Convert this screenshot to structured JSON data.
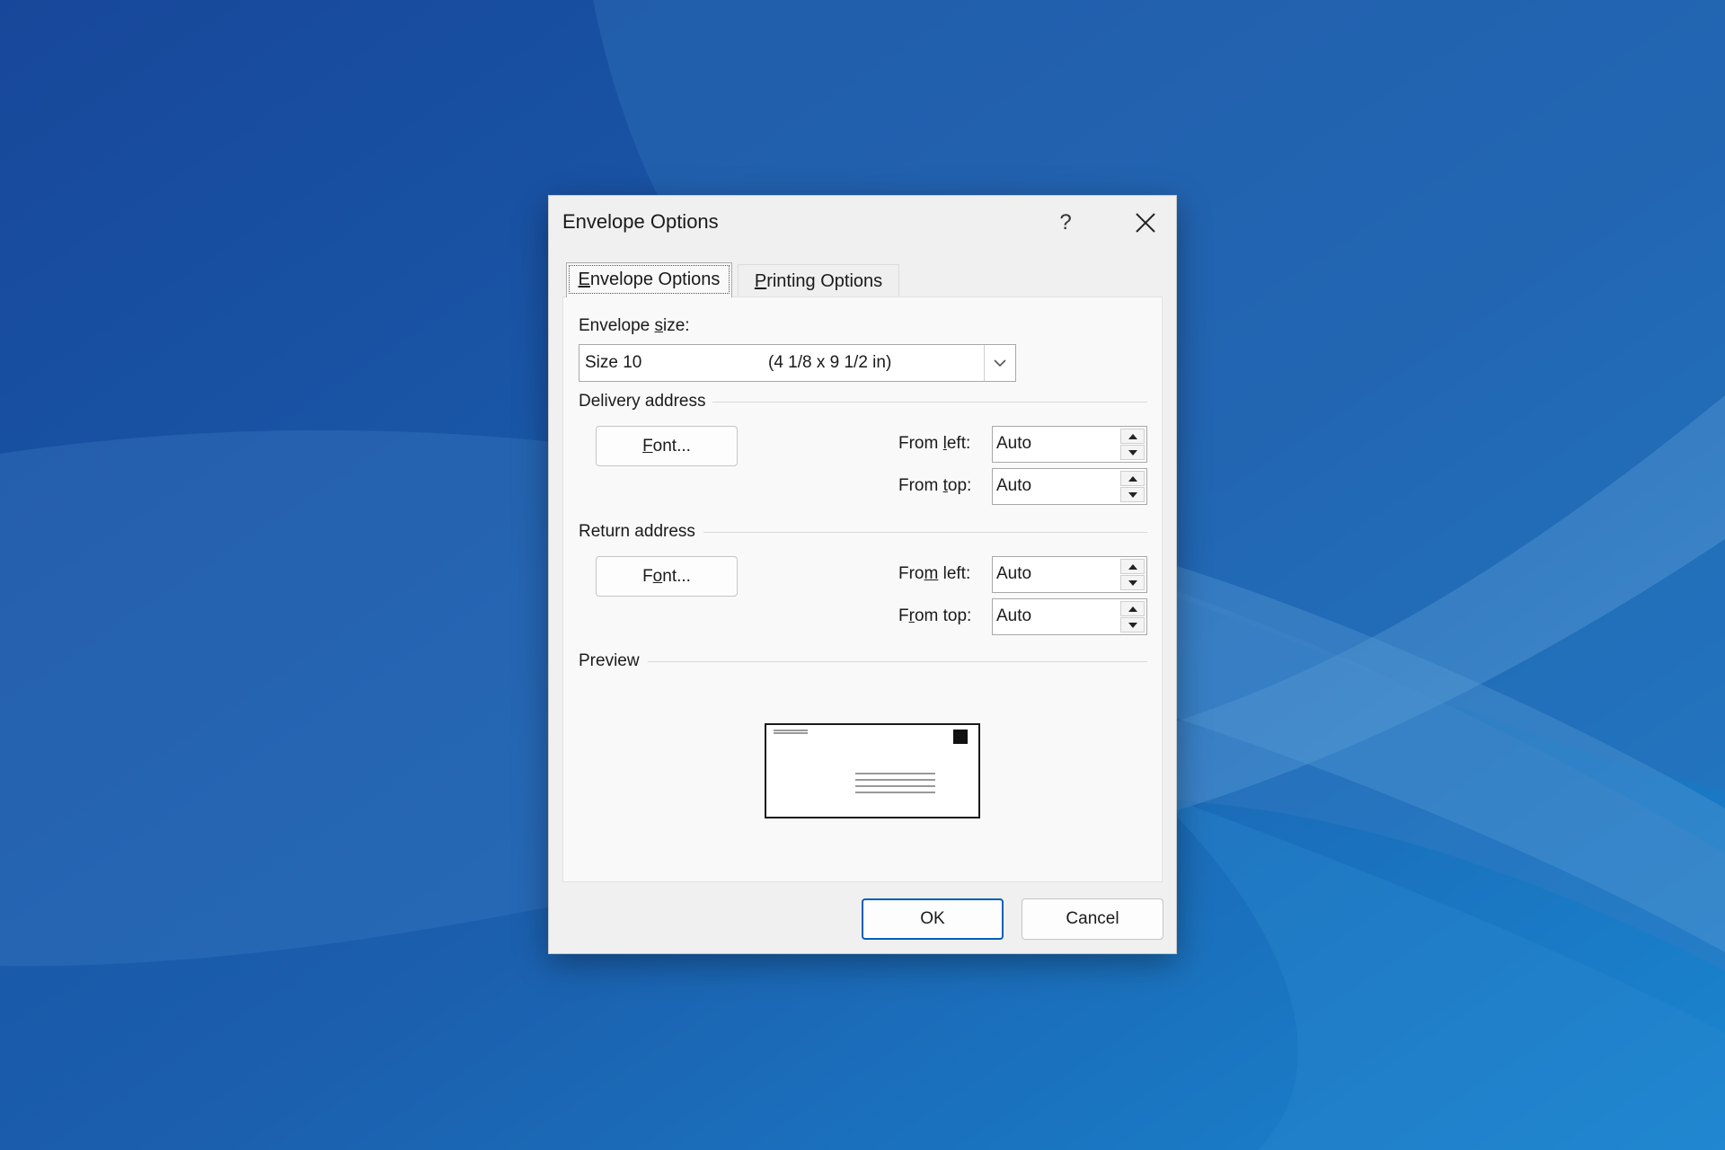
{
  "window": {
    "title": "Envelope Options",
    "help_label": "?"
  },
  "tabs": [
    {
      "label": "Envelope Options",
      "mnemonic": "E",
      "active": true
    },
    {
      "label": "Printing Options",
      "mnemonic": "P",
      "active": false
    }
  ],
  "envelope_size": {
    "label": "Envelope size:",
    "value_name": "Size 10",
    "value_dims": "(4 1/8 x 9 1/2 in)"
  },
  "delivery_address": {
    "group_label": "Delivery address",
    "font_button": "Font...",
    "from_left_label": "From left:",
    "from_left_value": "Auto",
    "from_top_label": "From top:",
    "from_top_value": "Auto"
  },
  "return_address": {
    "group_label": "Return address",
    "font_button": "Font...",
    "from_left_label": "From left:",
    "from_left_value": "Auto",
    "from_top_label": "From top:",
    "from_top_value": "Auto"
  },
  "preview": {
    "group_label": "Preview"
  },
  "buttons": {
    "ok": "OK",
    "cancel": "Cancel"
  },
  "colors": {
    "accent": "#005fb8",
    "desktop_base": "#1c5ea8",
    "dialog_bg": "#f0f0f0"
  },
  "icons": {
    "close": "close-icon",
    "dropdown": "chevron-down-icon",
    "spin_up": "spin-up-icon",
    "spin_down": "spin-down-icon"
  }
}
